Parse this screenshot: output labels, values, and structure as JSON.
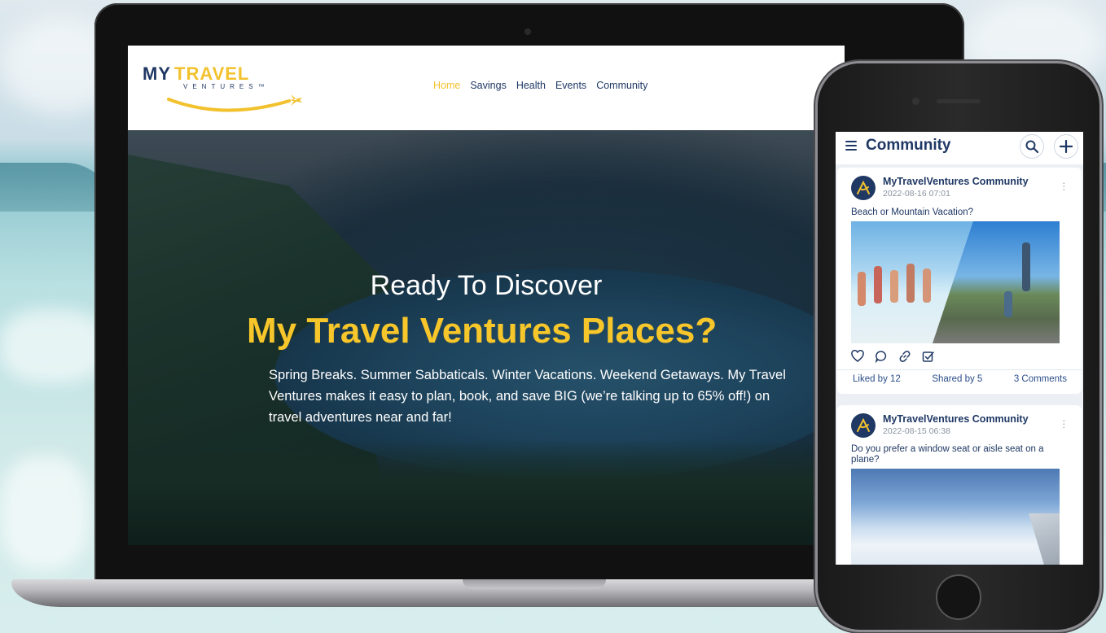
{
  "website": {
    "logo": {
      "my": "MY",
      "travel": "TRAVEL",
      "ventures": "VENTURES™"
    },
    "nav": [
      {
        "label": "Home",
        "active": true
      },
      {
        "label": "Savings",
        "active": false
      },
      {
        "label": "Health",
        "active": false
      },
      {
        "label": "Events",
        "active": false
      },
      {
        "label": "Community",
        "active": false
      }
    ],
    "hero": {
      "line1": "Ready To Discover",
      "line2": "My Travel Ventures Places?",
      "body": "Spring Breaks. Summer Sabbaticals. Winter Vacations. Weekend Getaways. My Travel Ventures makes it easy to plan, book, and save BIG (we’re talking up to 65% off!) on travel adventures near and far!"
    },
    "colors": {
      "navy": "#1f3864",
      "gold": "#f2c12e"
    }
  },
  "app": {
    "title": "Community",
    "icons": {
      "menu": "hamburger-icon",
      "search": "search-icon",
      "add": "plus-icon"
    },
    "posts": [
      {
        "author": "MyTravelVentures Community",
        "date": "2022-08-16 07:01",
        "text": "Beach or Mountain Vacation?",
        "liked": "Liked by 12",
        "shared": "Shared by 5",
        "comments": "3 Comments"
      },
      {
        "author": "MyTravelVentures Community",
        "date": "2022-08-15 06:38",
        "text": "Do you prefer a window seat or aisle seat on a plane?"
      }
    ]
  }
}
